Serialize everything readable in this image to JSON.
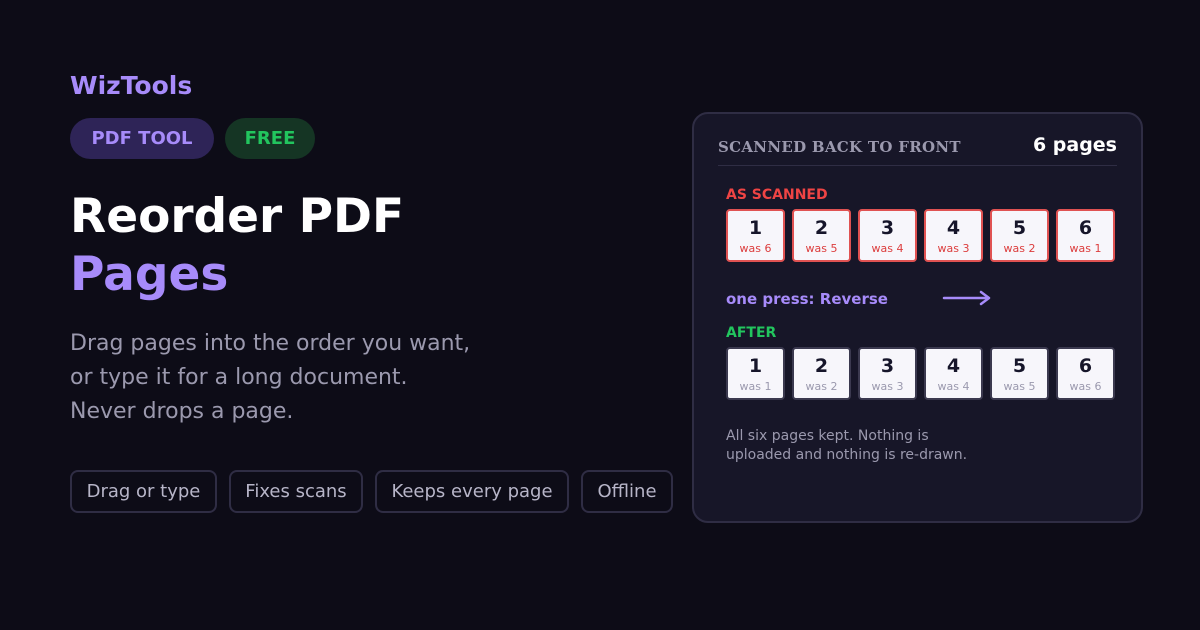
{
  "brand": "WizTools",
  "badges": {
    "tool": "PDF TOOL",
    "free": "FREE"
  },
  "headline": {
    "line1": "Reorder PDF",
    "line2": "Pages"
  },
  "description": [
    "Drag pages into the order you want,",
    "or type it for a long document.",
    "Never drops a page."
  ],
  "features": [
    "Drag or type",
    "Fixes scans",
    "Keeps every page",
    "Offline"
  ],
  "card": {
    "title": "SCANNED BACK TO FRONT",
    "count": "6 pages",
    "scanned_label": "AS SCANNED",
    "scanned": [
      {
        "num": "1",
        "was": "was 6"
      },
      {
        "num": "2",
        "was": "was 5"
      },
      {
        "num": "3",
        "was": "was 4"
      },
      {
        "num": "4",
        "was": "was 3"
      },
      {
        "num": "5",
        "was": "was 2"
      },
      {
        "num": "6",
        "was": "was 1"
      }
    ],
    "action": "one press: Reverse",
    "after_label": "AFTER",
    "after": [
      {
        "num": "1",
        "was": "was 1"
      },
      {
        "num": "2",
        "was": "was 2"
      },
      {
        "num": "3",
        "was": "was 3"
      },
      {
        "num": "4",
        "was": "was 4"
      },
      {
        "num": "5",
        "was": "was 5"
      },
      {
        "num": "6",
        "was": "was 6"
      }
    ],
    "note": [
      "All six pages kept. Nothing is",
      "uploaded and nothing is re-drawn."
    ]
  },
  "colors": {
    "background": "#0d0c17",
    "accent": "#a78bfa",
    "success": "#22c55e",
    "danger": "#ef4444"
  },
  "icons": {
    "action_arrow": "arrow-right-icon"
  }
}
